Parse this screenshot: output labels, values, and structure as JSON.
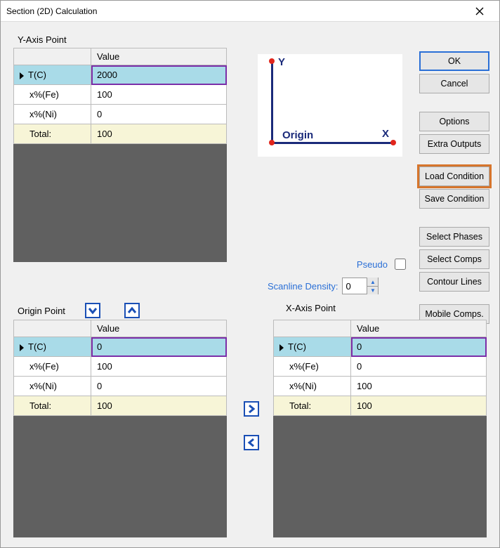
{
  "window": {
    "title": "Section (2D) Calculation"
  },
  "labels": {
    "yaxis": "Y-Axis Point",
    "origin": "Origin Point",
    "xaxis": "X-Axis Point",
    "value_header": "Value",
    "pseudo": "Pseudo",
    "scanline": "Scanline Density:"
  },
  "diagram": {
    "y": "Y",
    "x": "X",
    "origin": "Origin"
  },
  "scanline_value": "0",
  "pseudo_checked": false,
  "buttons": {
    "ok": "OK",
    "cancel": "Cancel",
    "options": "Options",
    "extra_outputs": "Extra Outputs",
    "load_condition": "Load Condition",
    "save_condition": "Save Condition",
    "select_phases": "Select Phases",
    "select_comps": "Select Comps",
    "contour_lines": "Contour Lines",
    "mobile_comps": "Mobile Comps."
  },
  "yaxis_table": {
    "rows": [
      {
        "name": "T(C)",
        "value": "2000",
        "active": true
      },
      {
        "name": "x%(Fe)",
        "value": "100"
      },
      {
        "name": "x%(Ni)",
        "value": "0"
      },
      {
        "name": "Total:",
        "value": "100",
        "total": true
      }
    ]
  },
  "origin_table": {
    "rows": [
      {
        "name": "T(C)",
        "value": "0",
        "active": true
      },
      {
        "name": "x%(Fe)",
        "value": "100"
      },
      {
        "name": "x%(Ni)",
        "value": "0"
      },
      {
        "name": "Total:",
        "value": "100",
        "total": true
      }
    ]
  },
  "xaxis_table": {
    "rows": [
      {
        "name": "T(C)",
        "value": "0",
        "active": true
      },
      {
        "name": "x%(Fe)",
        "value": "0"
      },
      {
        "name": "x%(Ni)",
        "value": "100"
      },
      {
        "name": "Total:",
        "value": "100",
        "total": true
      }
    ]
  }
}
